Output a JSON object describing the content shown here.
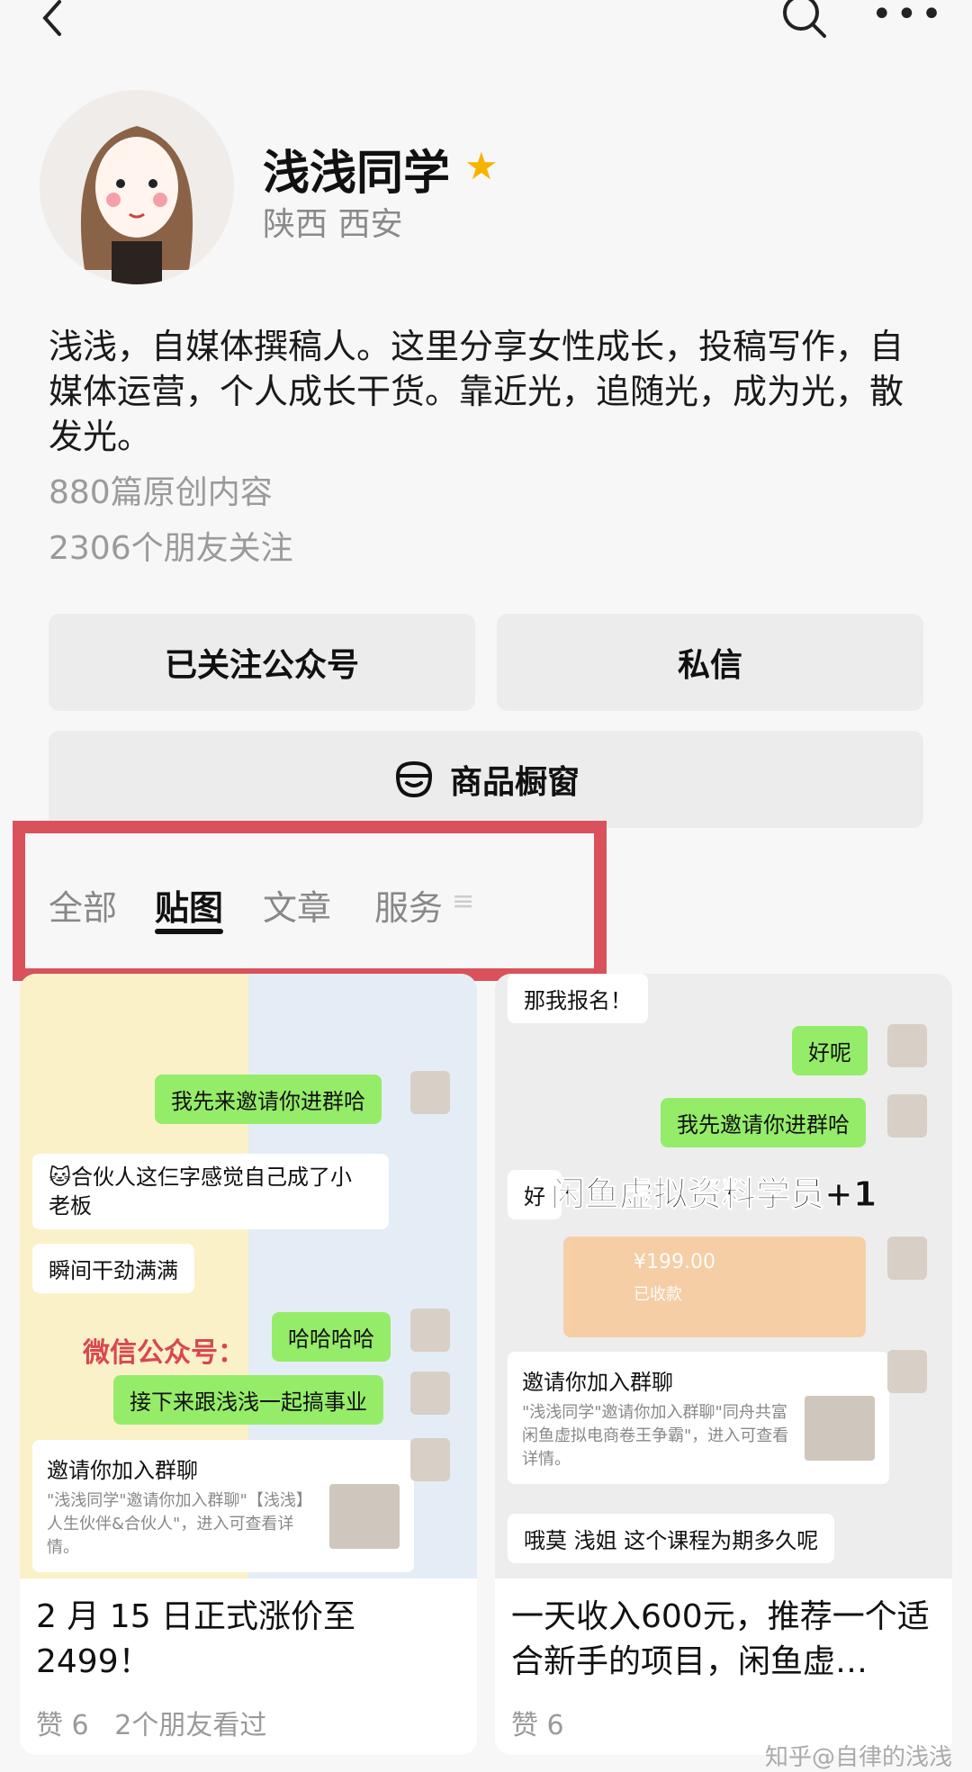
{
  "profile": {
    "name": "浅浅同学",
    "location": "陕西 西安",
    "bio": "浅浅，自媒体撰稿人。这里分享女性成长，投稿写作，自媒体运营，个人成长干货。靠近光，追随光，成为光，散发光。",
    "original_count": "880篇原创内容",
    "friends_following": "2306个朋友关注"
  },
  "actions": {
    "follow": "已关注公众号",
    "message": "私信",
    "shop": "商品橱窗"
  },
  "tabs": [
    {
      "label": "全部",
      "active": false
    },
    {
      "label": "贴图",
      "active": true
    },
    {
      "label": "文章",
      "active": false
    },
    {
      "label": "服务",
      "active": false
    }
  ],
  "cards": [
    {
      "title": "2 月 15 日正式涨价至 2499！",
      "likes": "赞 6",
      "friends_viewed": "2个朋友看过",
      "chat": {
        "g1": "我先来邀请你进群哈",
        "w1": "🐱合伙人这仨字感觉自己成了小老板",
        "w2": "瞬间干劲满满",
        "g2": "哈哈哈哈",
        "red": "微信公众号：",
        "g3": "接下来跟浅浅一起搞事业",
        "invite_title": "邀请你加入群聊",
        "invite_desc": "\"浅浅同学\"邀请你加入群聊\"【浅浅】人生伙伴&合伙人\"，进入可查看详情。"
      }
    },
    {
      "title": "一天收入600元，推荐一个适合新手的项目，闲鱼虚…",
      "likes": "赞 6",
      "chat": {
        "top": "那我报名！",
        "g1": "好呢",
        "g2": "我先邀请你进群哈",
        "big": "闲鱼虚拟资料学员+1",
        "hao": "好",
        "price": "¥199.00",
        "price_sub": "已收款",
        "invite_title": "邀请你加入群聊",
        "invite_desc": "\"浅浅同学\"邀请你加入群聊\"同舟共富闲鱼虚拟电商卷王争霸\"，进入可查看详情。",
        "w1": "哦莫 浅姐 这个课程为期多久呢"
      }
    }
  ],
  "watermark": "知乎@自律的浅浅",
  "colors": {
    "accent_red": "#d9525b",
    "wechat_green": "#95ec69",
    "star": "#f6b400"
  }
}
